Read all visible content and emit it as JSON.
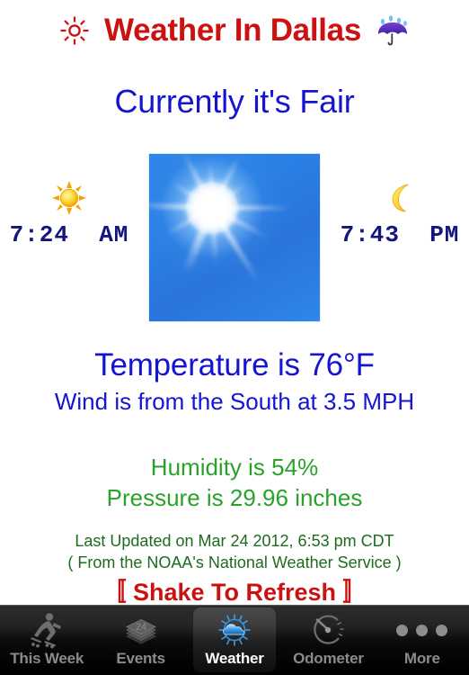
{
  "header": {
    "title": "Weather In Dallas",
    "left_icon": "sun-icon",
    "right_icon": "umbrella-rain-icon",
    "title_color": "#cc1111"
  },
  "condition": {
    "text": "Currently it's Fair"
  },
  "sun_times": {
    "sunrise": {
      "icon": "sun-emoji-icon",
      "time": "7:24  AM"
    },
    "sunset": {
      "icon": "crescent-moon-icon",
      "time": "7:43  PM"
    }
  },
  "photo": {
    "alt": "sunny-sky-photo"
  },
  "readings": {
    "temperature": "Temperature is 76°F",
    "wind": "Wind is from the South at 3.5 MPH",
    "humidity": "Humidity is 54%",
    "pressure": "Pressure is 29.96 inches",
    "temp_color": "#1414d2",
    "humidity_color": "#2aa22a"
  },
  "footer": {
    "updated": "Last Updated on Mar 24 2012, 6:53 pm CDT",
    "source": "( From the NOAA's National Weather Service )",
    "refresh": "〚 Shake To Refresh 〛"
  },
  "tabbar": {
    "tabs": [
      {
        "label": "This Week",
        "icon": "skater-icon",
        "active": false
      },
      {
        "label": "Events",
        "icon": "calendar-stack-icon",
        "active": false
      },
      {
        "label": "Weather",
        "icon": "sun-cloud-icon",
        "active": true
      },
      {
        "label": "Odometer",
        "icon": "gauge-icon",
        "active": false
      },
      {
        "label": "More",
        "icon": "ellipsis-icon",
        "active": false
      }
    ]
  }
}
